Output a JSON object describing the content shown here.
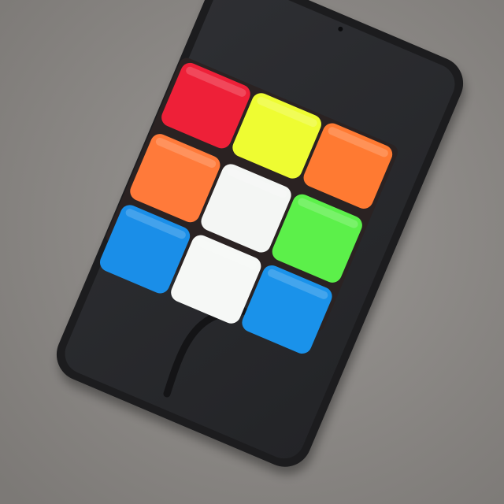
{
  "scene": {
    "description_hidden": "",
    "colors": {
      "table_surface": "#8a8784",
      "phone_body": "#1c1c1e",
      "phone_screen": "#2a2b2e",
      "cable": "#141416",
      "cube_plastic": "#2a2222"
    },
    "cube_face": {
      "rows": [
        [
          {
            "name": "cube-tile-red",
            "color": "#ee2038"
          },
          {
            "name": "cube-tile-yellow",
            "color": "#eefc32"
          },
          {
            "name": "cube-tile-orange-top-right",
            "color": "#ff7a32"
          }
        ],
        [
          {
            "name": "cube-tile-orange-middle-left",
            "color": "#ff7a3a"
          },
          {
            "name": "cube-tile-white-center",
            "color": "#f4f6f4"
          },
          {
            "name": "cube-tile-green",
            "color": "#5cf04a"
          }
        ],
        [
          {
            "name": "cube-tile-blue-left",
            "color": "#1a8ee8"
          },
          {
            "name": "cube-tile-white-bottom",
            "color": "#f6f8f6"
          },
          {
            "name": "cube-tile-blue-right",
            "color": "#1a92ea"
          }
        ]
      ]
    }
  }
}
